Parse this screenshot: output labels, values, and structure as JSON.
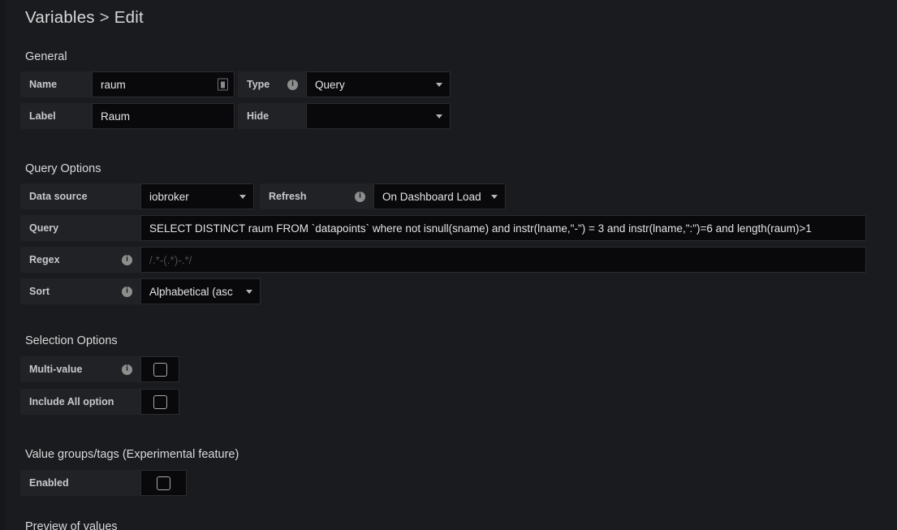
{
  "header": {
    "breadcrumb_root": "Variables",
    "separator": ">",
    "breadcrumb_current": "Edit"
  },
  "sections": {
    "general": {
      "title": "General",
      "name_label": "Name",
      "name_value": "raum",
      "name_icon": "text-cursor-icon",
      "label_label": "Label",
      "label_value": "Raum",
      "type_label": "Type",
      "type_value": "Query",
      "hide_label": "Hide",
      "hide_value": ""
    },
    "query_options": {
      "title": "Query Options",
      "datasource_label": "Data source",
      "datasource_value": "iobroker",
      "refresh_label": "Refresh",
      "refresh_value": "On Dashboard Load",
      "query_label": "Query",
      "query_value": "SELECT DISTINCT raum FROM `datapoints` where not isnull(sname) and instr(lname,\"-\") = 3 and instr(lname,\":\")=6  and length(raum)>1",
      "regex_label": "Regex",
      "regex_value": "",
      "regex_placeholder": "/.*-(.*)-.*/",
      "sort_label": "Sort",
      "sort_value": "Alphabetical (asc"
    },
    "selection_options": {
      "title": "Selection Options",
      "multi_value_label": "Multi-value",
      "multi_value_checked": false,
      "include_all_label": "Include All option",
      "include_all_checked": false
    },
    "value_groups": {
      "title": "Value groups/tags (Experimental feature)",
      "enabled_label": "Enabled",
      "enabled_checked": false
    },
    "cut_off": {
      "title": "Preview of values"
    }
  },
  "colors": {
    "page_background": "#1a1b1e",
    "label_cell": "#202226",
    "input_background": "#09090b",
    "text": "#d8d9da",
    "placeholder": "#4a4b50"
  }
}
